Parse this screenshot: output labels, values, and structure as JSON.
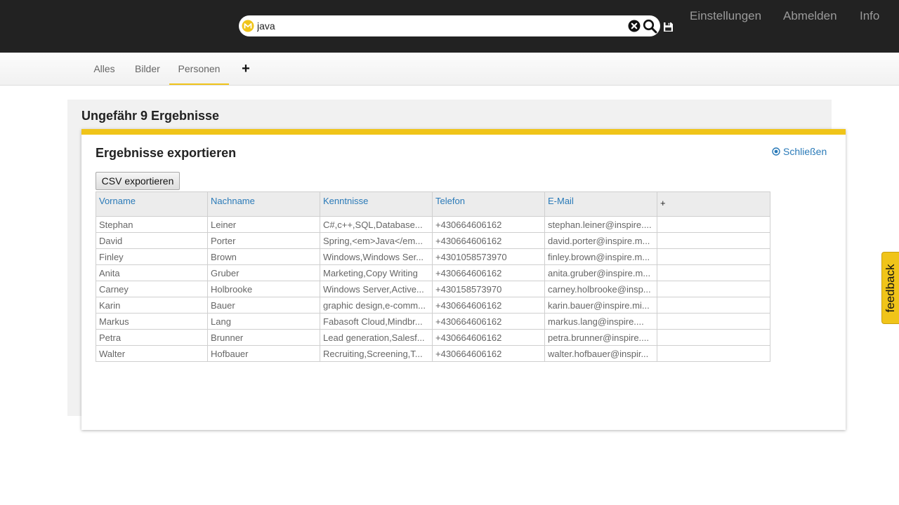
{
  "header": {
    "search": {
      "value": "java",
      "placeholder": ""
    },
    "nav": {
      "settings": "Einstellungen",
      "logout": "Abmelden",
      "info": "Info"
    }
  },
  "tabs": {
    "all": "Alles",
    "images": "Bilder",
    "people": "Personen",
    "add": "+"
  },
  "results": {
    "count_label": "Ungefähr 9 Ergebnisse"
  },
  "export_dialog": {
    "title": "Ergebnisse exportieren",
    "close_label": "Schließen",
    "csv_button": "CSV exportieren",
    "columns": [
      "Vorname",
      "Nachname",
      "Kenntnisse",
      "Telefon",
      "E-Mail",
      "+"
    ],
    "rows": [
      [
        "Stephan",
        "Leiner",
        "C#,c++,SQL,Database...",
        "+430664606162",
        "stephan.leiner@inspire....",
        ""
      ],
      [
        "David",
        "Porter",
        "Spring,<em>Java</em...",
        "+430664606162",
        "david.porter@inspire.m...",
        ""
      ],
      [
        "Finley",
        "Brown",
        "Windows,Windows Ser...",
        "+4301058573970",
        "finley.brown@inspire.m...",
        ""
      ],
      [
        "Anita",
        "Gruber",
        "Marketing,Copy Writing",
        "+430664606162",
        "anita.gruber@inspire.m...",
        ""
      ],
      [
        "Carney",
        "Holbrooke",
        "Windows Server,Active...",
        "+430158573970",
        "carney.holbrooke@insp...",
        ""
      ],
      [
        "Karin",
        "Bauer",
        "graphic design,e-comm...",
        "+430664606162",
        "karin.bauer@inspire.mi...",
        ""
      ],
      [
        "Markus",
        "Lang",
        "Fabasoft Cloud,Mindbr...",
        "+430664606162",
        "markus.lang@inspire....",
        ""
      ],
      [
        "Petra",
        "Brunner",
        "Lead generation,Salesf...",
        "+430664606162",
        "petra.brunner@inspire....",
        ""
      ],
      [
        "Walter",
        "Hofbauer",
        "Recruiting,Screening,T...",
        "+430664606162",
        "walter.hofbauer@inspir...",
        ""
      ]
    ]
  },
  "feedback": {
    "label": "feedback"
  },
  "colors": {
    "header_bg": "#222222",
    "accent": "#f0c419",
    "link": "#2a7ab8"
  }
}
